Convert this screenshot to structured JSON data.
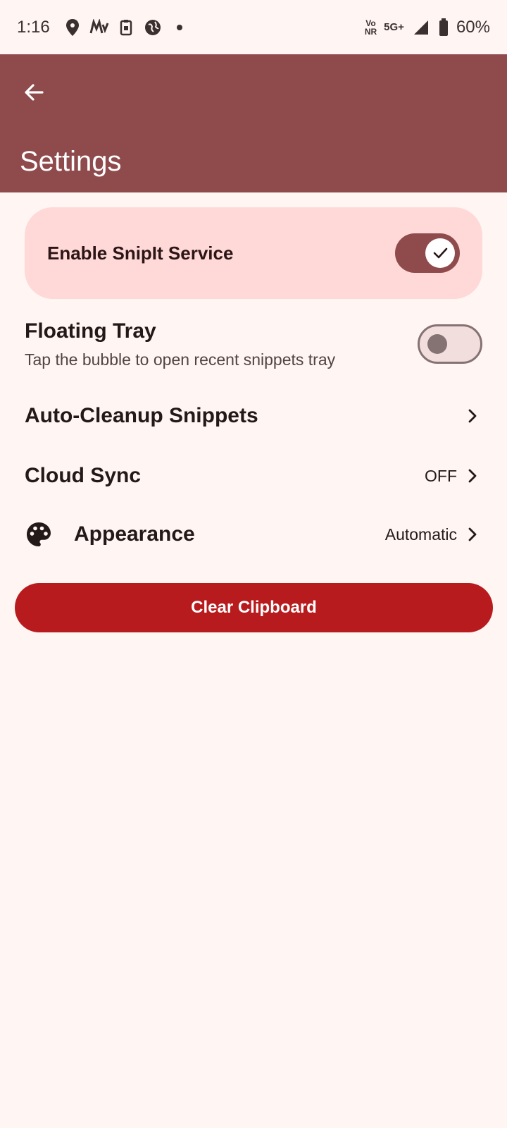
{
  "status_bar": {
    "time": "1:16",
    "network_top": "Vo",
    "network_bottom": "NR",
    "signal_type": "5G+",
    "battery": "60%",
    "notification_icons": [
      "location-pin-icon",
      "myntra-app-icon",
      "clipboard-app-icon",
      "vpn-globe-icon",
      "more-dot-icon"
    ]
  },
  "app_bar": {
    "title": "Settings",
    "color": "#8f4a4c"
  },
  "master_switch": {
    "label": "Enable SnipIt Service",
    "enabled": true
  },
  "settings": {
    "floating_tray": {
      "title": "Floating Tray",
      "subtitle": "Tap the bubble to open recent snippets tray",
      "enabled": false
    },
    "auto_cleanup": {
      "title": "Auto-Cleanup Snippets"
    },
    "cloud_sync": {
      "title": "Cloud Sync",
      "value": "OFF"
    },
    "appearance": {
      "title": "Appearance",
      "value": "Automatic",
      "icon": "palette-icon"
    }
  },
  "clear_button": {
    "label": "Clear Clipboard",
    "color": "#b81b1d"
  }
}
